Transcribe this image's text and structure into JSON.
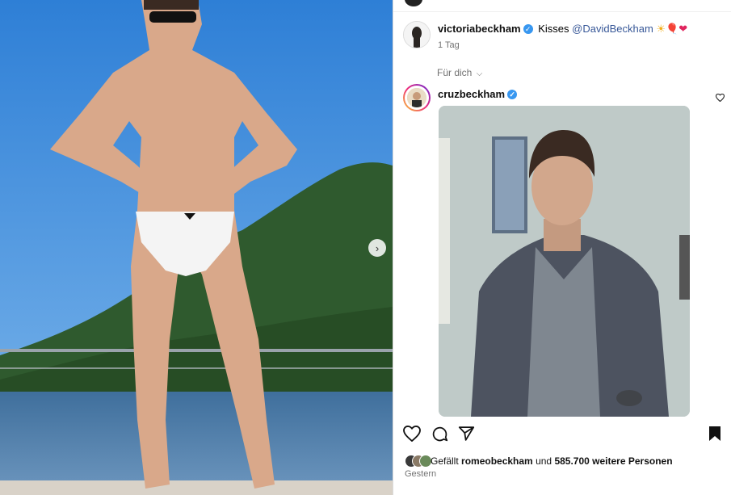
{
  "comment": {
    "username": "victoriabeckham",
    "text": "Kisses",
    "mention": "@DavidBeckham",
    "emojis": {
      "sun": "☀",
      "balloon": "🎈",
      "heart": "❤"
    },
    "time": "1 Tag"
  },
  "feed_filter": {
    "label": "Für dich",
    "chevron": "⌵"
  },
  "post": {
    "username": "cruzbeckham",
    "likes_prefix": "Gefällt",
    "liked_by": "romeobeckham",
    "likes_and": "und",
    "likes_others": "585.700 weitere Personen",
    "date": "Gestern"
  },
  "icons": {
    "next": "chevron-right-icon",
    "like": "heart-icon",
    "comment": "comment-icon",
    "share": "send-icon",
    "save": "bookmark-icon",
    "verified": "verified-badge-icon"
  },
  "colors": {
    "verified": "#3897f0",
    "mention": "#385898",
    "muted": "#737373"
  }
}
